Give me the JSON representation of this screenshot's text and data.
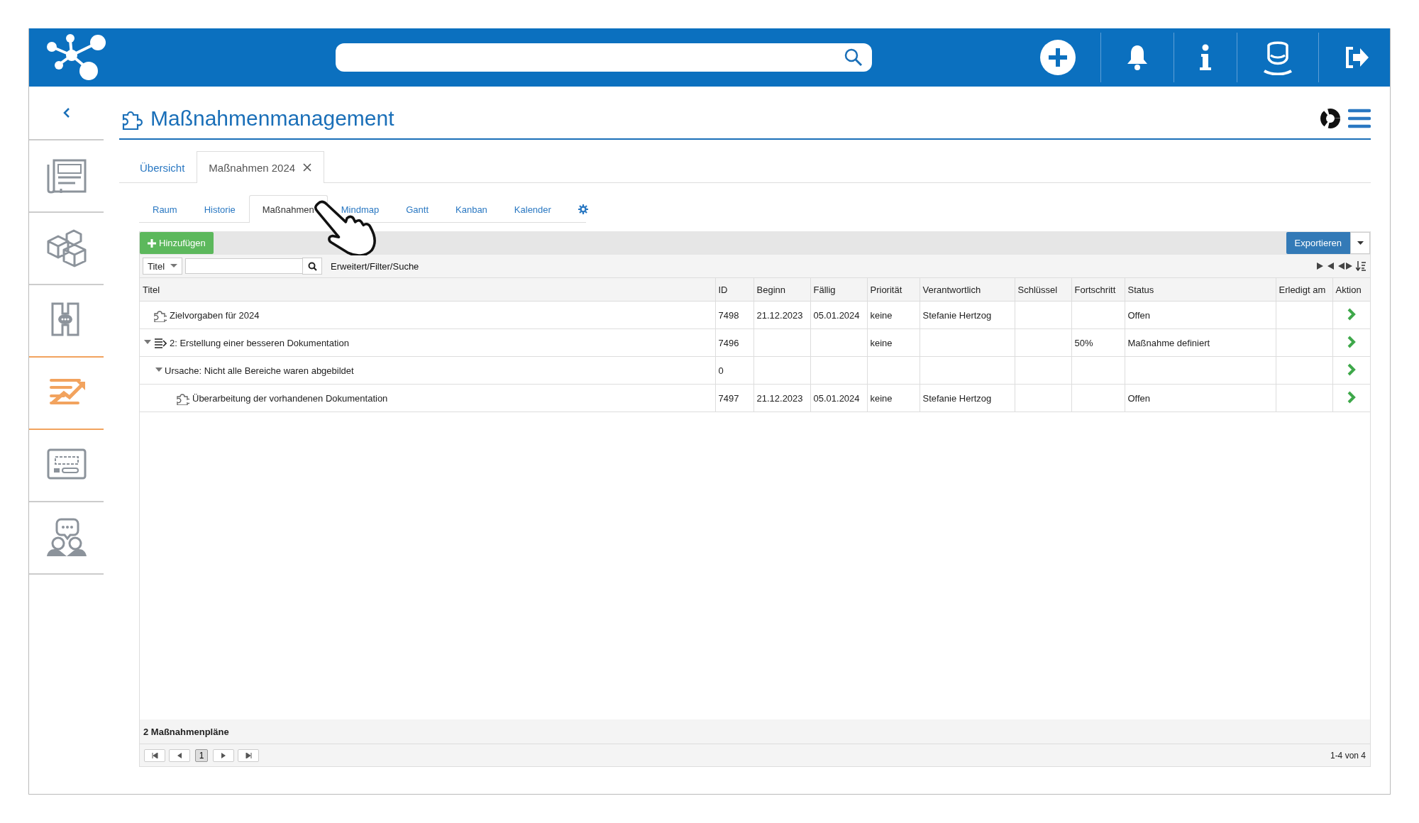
{
  "sidebar": {
    "items": [
      {
        "selected": false
      },
      {
        "selected": false
      },
      {
        "selected": false
      },
      {
        "selected": true
      },
      {
        "selected": false
      },
      {
        "selected": false
      }
    ]
  },
  "page": {
    "title": "Maßnahmenmanagement"
  },
  "tabs": [
    {
      "label": "Übersicht",
      "selected": false,
      "closable": false
    },
    {
      "label": "Maßnahmen 2024",
      "selected": true,
      "closable": true
    }
  ],
  "subtabs": [
    {
      "label": "Raum",
      "selected": false
    },
    {
      "label": "Historie",
      "selected": false
    },
    {
      "label": "Maßnahmen",
      "selected": true
    },
    {
      "label": "Mindmap",
      "selected": false
    },
    {
      "label": "Gantt",
      "selected": false
    },
    {
      "label": "Kanban",
      "selected": false
    },
    {
      "label": "Kalender",
      "selected": false
    }
  ],
  "toolbar": {
    "add_button": "Hinzufügen",
    "export_button": "Exportieren"
  },
  "filter": {
    "field": "Titel",
    "link": "Erweitert/Filter/Suche"
  },
  "table": {
    "columns": [
      "Titel",
      "ID",
      "Beginn",
      "Fällig",
      "Priorität",
      "Verantwortlich",
      "Schlüssel",
      "Fortschritt",
      "Status",
      "Erledigt am",
      "Aktion"
    ],
    "rows": [
      {
        "title": "Zielvorgaben für 2024",
        "kind": "goal",
        "id": "7498",
        "begin": "21.12.2023",
        "due": "05.01.2024",
        "priority": "keine",
        "owner": "Stefanie Hertzog",
        "status": "Offen"
      },
      {
        "title": "2: Erstellung einer besseren Dokumentation",
        "kind": "plan",
        "expanded": true,
        "id": "7496",
        "priority": "keine",
        "progress": "50%",
        "status": "Maßnahme definiert",
        "children": [
          {
            "title": "Ursache: Nicht alle Bereiche waren abgebildet",
            "expanded": true,
            "id": "0",
            "children": [
              {
                "title": "Überarbeitung der vorhandenen Dokumentation",
                "kind": "task",
                "id": "7497",
                "begin": "21.12.2023",
                "due": "05.01.2024",
                "priority": "keine",
                "owner": "Stefanie Hertzog",
                "status": "Offen"
              }
            ]
          }
        ]
      }
    ]
  },
  "summary": "2 Maßnahmenpläne",
  "pager": {
    "pages": [
      {
        "label": "1",
        "selected": true
      }
    ],
    "range": "1-4 von 4"
  }
}
